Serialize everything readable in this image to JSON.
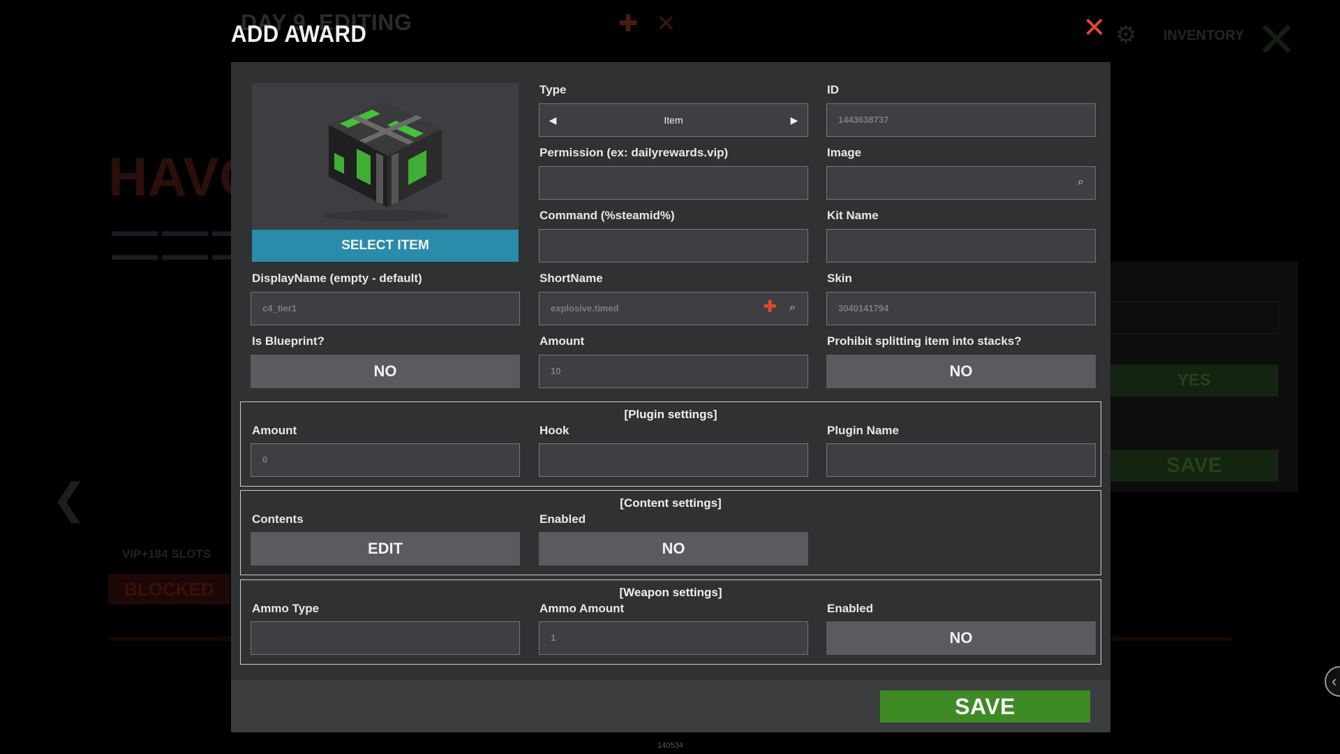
{
  "background": {
    "title": "DAY 9, EDITING",
    "inventory": "INVENTORY",
    "side_yes": "YES",
    "side_save": "SAVE",
    "blocked": "BLOCKED",
    "vip_slots": "VIP+184 SLOTS",
    "version": "140534"
  },
  "modal": {
    "title": "ADD AWARD",
    "select_item_label": "SELECT ITEM",
    "type": {
      "label": "Type",
      "value": "Item"
    },
    "id": {
      "label": "ID",
      "value": "1443638737"
    },
    "permission": {
      "label": "Permission (ex: dailyrewards.vip)",
      "value": ""
    },
    "image": {
      "label": "Image",
      "value": ""
    },
    "command": {
      "label": "Command (%steamid%)",
      "value": ""
    },
    "kit_name": {
      "label": "Kit Name",
      "value": ""
    },
    "display_name": {
      "label": "DisplayName (empty - default)",
      "value": "c4_tier1"
    },
    "short_name": {
      "label": "ShortName",
      "value": "explosive.timed"
    },
    "skin": {
      "label": "Skin",
      "value": "3040141794"
    },
    "is_blueprint": {
      "label": "Is Blueprint?",
      "value": "NO"
    },
    "amount": {
      "label": "Amount",
      "value": "10"
    },
    "prohibit_split": {
      "label": "Prohibit splitting item into stacks?",
      "value": "NO"
    },
    "plugin_settings": {
      "title": "[Plugin settings]",
      "amount": {
        "label": "Amount",
        "value": "0"
      },
      "hook": {
        "label": "Hook",
        "value": ""
      },
      "plugin_name": {
        "label": "Plugin Name",
        "value": ""
      }
    },
    "content_settings": {
      "title": "[Content settings]",
      "contents": {
        "label": "Contents",
        "value": "EDIT"
      },
      "enabled": {
        "label": "Enabled",
        "value": "NO"
      }
    },
    "weapon_settings": {
      "title": "[Weapon settings]",
      "ammo_type": {
        "label": "Ammo Type",
        "value": ""
      },
      "ammo_amount": {
        "label": "Ammo Amount",
        "value": "1"
      },
      "enabled": {
        "label": "Enabled",
        "value": "NO"
      }
    },
    "save_label": "SAVE"
  },
  "icons": {
    "close": "close-icon",
    "search": "search-icon",
    "plus": "plus-icon",
    "arrow_left": "arrow-left-icon",
    "arrow_right": "arrow-right-icon"
  },
  "colors": {
    "accent_blue": "#2a8bab",
    "save_green": "#3e8a25",
    "close_red": "#e14a2c",
    "button_gray": "#595b5e",
    "modal_bg": "#2f3133"
  }
}
